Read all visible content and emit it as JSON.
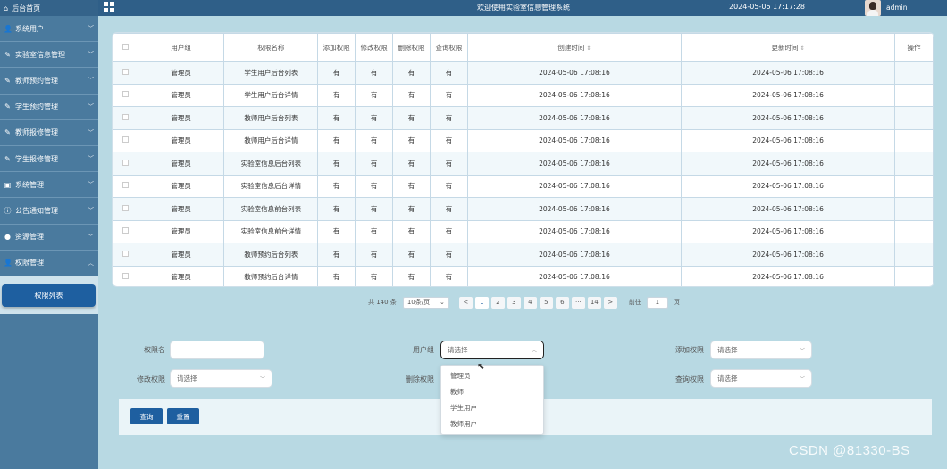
{
  "sidebar": {
    "home": "后台首页",
    "items": [
      {
        "label": "系统用户",
        "icon": "user-icon"
      },
      {
        "label": "实验室信息管理",
        "icon": "edit-icon"
      },
      {
        "label": "教师预约管理",
        "icon": "edit-icon"
      },
      {
        "label": "学生预约管理",
        "icon": "edit-icon"
      },
      {
        "label": "教师报修管理",
        "icon": "edit-icon"
      },
      {
        "label": "学生报修管理",
        "icon": "edit-icon"
      },
      {
        "label": "系统管理",
        "icon": "picture-icon"
      },
      {
        "label": "公告通知管理",
        "icon": "info-icon"
      },
      {
        "label": "资源管理",
        "icon": "location-icon"
      },
      {
        "label": "权限管理",
        "icon": "user-icon"
      }
    ],
    "sub_item": "权限列表"
  },
  "header": {
    "title": "欢迎使用实验室信息管理系统",
    "datetime": "2024-05-06 17:17:28",
    "username": "admin"
  },
  "table": {
    "columns": [
      "",
      "用户组",
      "权限名称",
      "添加权限",
      "修改权限",
      "删除权限",
      "查询权限",
      "创建时间",
      "更新时间",
      "操作"
    ],
    "rows": [
      [
        "管理员",
        "学生用户后台列表",
        "有",
        "有",
        "有",
        "有",
        "2024-05-06 17:08:16",
        "2024-05-06 17:08:16"
      ],
      [
        "管理员",
        "学生用户后台详情",
        "有",
        "有",
        "有",
        "有",
        "2024-05-06 17:08:16",
        "2024-05-06 17:08:16"
      ],
      [
        "管理员",
        "教师用户后台列表",
        "有",
        "有",
        "有",
        "有",
        "2024-05-06 17:08:16",
        "2024-05-06 17:08:16"
      ],
      [
        "管理员",
        "教师用户后台详情",
        "有",
        "有",
        "有",
        "有",
        "2024-05-06 17:08:16",
        "2024-05-06 17:08:16"
      ],
      [
        "管理员",
        "实验室信息后台列表",
        "有",
        "有",
        "有",
        "有",
        "2024-05-06 17:08:16",
        "2024-05-06 17:08:16"
      ],
      [
        "管理员",
        "实验室信息后台详情",
        "有",
        "有",
        "有",
        "有",
        "2024-05-06 17:08:16",
        "2024-05-06 17:08:16"
      ],
      [
        "管理员",
        "实验室信息前台列表",
        "有",
        "有",
        "有",
        "有",
        "2024-05-06 17:08:16",
        "2024-05-06 17:08:16"
      ],
      [
        "管理员",
        "实验室信息前台详情",
        "有",
        "有",
        "有",
        "有",
        "2024-05-06 17:08:16",
        "2024-05-06 17:08:16"
      ],
      [
        "管理员",
        "教师预约后台列表",
        "有",
        "有",
        "有",
        "有",
        "2024-05-06 17:08:16",
        "2024-05-06 17:08:16"
      ],
      [
        "管理员",
        "教师预约后台详情",
        "有",
        "有",
        "有",
        "有",
        "2024-05-06 17:08:16",
        "2024-05-06 17:08:16"
      ]
    ]
  },
  "pagination": {
    "total": "共 140 条",
    "page_size": "10条/页",
    "prev": "<",
    "pages": [
      "1",
      "2",
      "3",
      "4",
      "5",
      "6",
      "···",
      "14",
      ">"
    ],
    "current_page": "1",
    "goto_label": "前往",
    "goto_value": "1",
    "goto_suffix": "页"
  },
  "search": {
    "perm_name_label": "权限名",
    "perm_name_value": "",
    "user_group_label": "用户组",
    "user_group_placeholder": "请选择",
    "add_perm_label": "添加权限",
    "add_perm_placeholder": "请选择",
    "edit_perm_label": "修改权限",
    "edit_perm_placeholder": "请选择",
    "delete_perm_label": "删除权限",
    "query_perm_label": "查询权限",
    "query_perm_placeholder": "请选择",
    "query_button": "查询",
    "reset_button": "重置",
    "dropdown_options": [
      "管理员",
      "教师",
      "学生用户",
      "教师用户"
    ]
  },
  "watermark": "CSDN @81330-BS",
  "colors": {
    "sidebar": "#4a7a9e",
    "topbar": "#2f5f88",
    "background": "#b8d9e3",
    "accent": "#1e5fa0"
  }
}
